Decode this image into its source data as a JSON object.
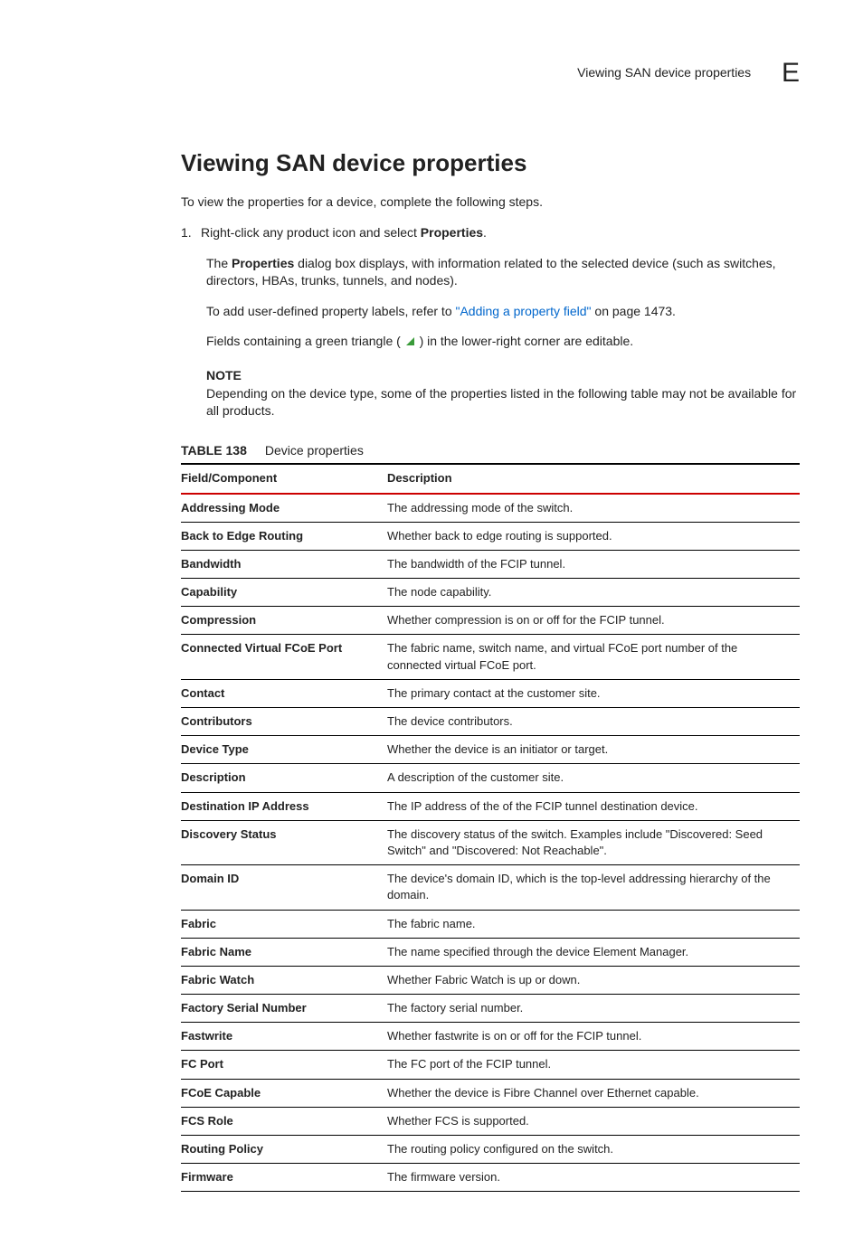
{
  "header": {
    "running_title": "Viewing SAN device properties",
    "appendix_letter": "E"
  },
  "main": {
    "heading": "Viewing SAN device properties",
    "intro": "To view the properties for a device, complete the following steps.",
    "step_number": "1.",
    "step_text_prefix": "Right-click any product icon and select ",
    "step_text_bold": "Properties",
    "step_text_suffix": ".",
    "para2_prefix": "The ",
    "para2_bold": "Properties",
    "para2_suffix": " dialog box displays, with information related to the selected device (such as switches, directors, HBAs, trunks, tunnels, and nodes).",
    "para3_prefix": "To add user-defined property labels, refer to ",
    "para3_link": "\"Adding a property field\"",
    "para3_suffix": " on page 1473.",
    "para4_prefix": "Fields containing a green triangle ( ",
    "para4_suffix": " ) in the lower-right corner are editable.",
    "note_label": "NOTE",
    "note_text": "Depending on the device type, some of the properties listed in the following table may not be available for all products."
  },
  "table": {
    "caption_number": "TABLE 138",
    "caption_title": "Device properties",
    "header_field": "Field/Component",
    "header_desc": "Description",
    "rows": [
      {
        "field": "Addressing Mode",
        "desc": "The addressing mode of the switch."
      },
      {
        "field": "Back to Edge Routing",
        "desc": "Whether back to edge routing is supported."
      },
      {
        "field": "Bandwidth",
        "desc": "The bandwidth of the FCIP tunnel."
      },
      {
        "field": "Capability",
        "desc": "The node capability."
      },
      {
        "field": "Compression",
        "desc": "Whether compression is on or off for the FCIP tunnel."
      },
      {
        "field": "Connected Virtual FCoE Port",
        "desc": "The fabric name, switch name, and virtual FCoE port number of the connected virtual FCoE port."
      },
      {
        "field": "Contact",
        "desc": "The primary contact at the customer site."
      },
      {
        "field": "Contributors",
        "desc": "The device contributors."
      },
      {
        "field": "Device Type",
        "desc": "Whether the device is an initiator or target."
      },
      {
        "field": "Description",
        "desc": "A description of the customer site."
      },
      {
        "field": "Destination IP Address",
        "desc": "The IP address of the of the FCIP tunnel destination device."
      },
      {
        "field": "Discovery Status",
        "desc": "The discovery status of the switch. Examples include \"Discovered: Seed Switch\" and \"Discovered: Not Reachable\"."
      },
      {
        "field": "Domain ID",
        "desc": "The device's domain ID, which is the top-level addressing hierarchy of the domain."
      },
      {
        "field": "Fabric",
        "desc": "The fabric name."
      },
      {
        "field": "Fabric Name",
        "desc": "The name specified through the device Element Manager."
      },
      {
        "field": "Fabric Watch",
        "desc": "Whether Fabric Watch is up or down."
      },
      {
        "field": "Factory Serial Number",
        "desc": "The factory serial number."
      },
      {
        "field": "Fastwrite",
        "desc": "Whether fastwrite is on or off for the FCIP tunnel."
      },
      {
        "field": "FC Port",
        "desc": "The FC port of the FCIP tunnel."
      },
      {
        "field": "FCoE Capable",
        "desc": "Whether the device is Fibre Channel over Ethernet capable."
      },
      {
        "field": "FCS Role",
        "desc": "Whether FCS is supported."
      },
      {
        "field": "Routing Policy",
        "desc": "The routing policy configured on the switch."
      },
      {
        "field": "Firmware",
        "desc": "The firmware version."
      }
    ]
  }
}
